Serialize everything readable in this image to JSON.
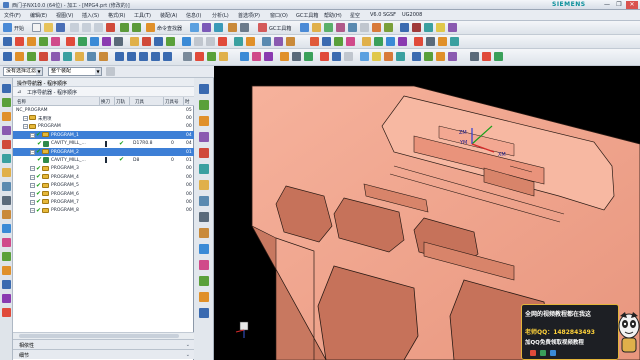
{
  "window": {
    "title": "西门子NX10.0 (64位) - 加工 - [MPG4.prt (修改的)]",
    "brand": "SIEMENS",
    "buttons": {
      "minimize": "—",
      "maximize": "❐",
      "close": "✕"
    }
  },
  "menu": [
    "文件(F)",
    "编辑(E)",
    "视图(V)",
    "插入(S)",
    "格式(R)",
    "工具(T)",
    "装配(A)",
    "信息(I)",
    "分析(L)",
    "首选项(P)",
    "窗口(O)",
    "GC工具箱",
    "帮助(H)",
    "星空",
    "V6.0  SGSF",
    "UG2008"
  ],
  "toolbar_labels": {
    "start": "开始",
    "view": "命令查找器",
    "gc": "GC工具箱"
  },
  "filter": {
    "selection": "没有选择过滤器",
    "scope": "整个装配"
  },
  "navigator": {
    "title": "操作导航器 - 程序顺序",
    "subtitle": "工序导航器 - 程序顺序",
    "columns": [
      "名称",
      "换刀",
      "刀轨",
      "刀具",
      "刀具号",
      "时"
    ],
    "rows": [
      {
        "name": "NC_PROGRAM",
        "change": "",
        "path": "",
        "tool": "",
        "num": "",
        "time": "05",
        "level": 0,
        "icon": "none",
        "selected": false
      },
      {
        "name": "未用项",
        "change": "",
        "path": "",
        "tool": "",
        "num": "",
        "time": "00",
        "level": 1,
        "icon": "folder",
        "selected": false
      },
      {
        "name": "PROGRAM",
        "change": "",
        "path": "",
        "tool": "",
        "num": "",
        "time": "00",
        "level": 1,
        "icon": "folder",
        "selected": false
      },
      {
        "name": "PROGRAM_1",
        "change": "",
        "path": "",
        "tool": "",
        "num": "",
        "time": "04",
        "level": 2,
        "icon": "folder",
        "selected": true
      },
      {
        "name": "CAVITY_MILL_...",
        "change": "bar",
        "path": "✔",
        "tool": "D17R0.8",
        "num": "0",
        "time": "04",
        "level": 3,
        "icon": "mill",
        "selected": false
      },
      {
        "name": "PROGRAM_2",
        "change": "",
        "path": "",
        "tool": "",
        "num": "",
        "time": "01",
        "level": 2,
        "icon": "folder",
        "selected": true
      },
      {
        "name": "CAVITY_MILL_...",
        "change": "bar",
        "path": "✔",
        "tool": "D8",
        "num": "0",
        "time": "01",
        "level": 3,
        "icon": "mill",
        "selected": false
      },
      {
        "name": "PROGRAM_3",
        "change": "",
        "path": "",
        "tool": "",
        "num": "",
        "time": "00",
        "level": 2,
        "icon": "folder",
        "selected": false
      },
      {
        "name": "PROGRAM_4",
        "change": "",
        "path": "",
        "tool": "",
        "num": "",
        "time": "00",
        "level": 2,
        "icon": "folder",
        "selected": false
      },
      {
        "name": "PROGRAM_5",
        "change": "",
        "path": "",
        "tool": "",
        "num": "",
        "time": "00",
        "level": 2,
        "icon": "folder",
        "selected": false
      },
      {
        "name": "PROGRAM_6",
        "change": "",
        "path": "",
        "tool": "",
        "num": "",
        "time": "00",
        "level": 2,
        "icon": "folder",
        "selected": false
      },
      {
        "name": "PROGRAM_7",
        "change": "",
        "path": "",
        "tool": "",
        "num": "",
        "time": "00",
        "level": 2,
        "icon": "folder",
        "selected": false
      },
      {
        "name": "PROGRAM_8",
        "change": "",
        "path": "",
        "tool": "",
        "num": "",
        "time": "00",
        "level": 2,
        "icon": "folder",
        "selected": false
      }
    ],
    "footer": [
      "相依性",
      "细节"
    ]
  },
  "axes": {
    "x": "XM",
    "y": "YM",
    "z": "ZM"
  },
  "promo": {
    "line1": "全网的视频教程都在我这",
    "line2": "老师QQ：1482843493",
    "line3": "加QQ免费领取视频教程"
  },
  "colors": {
    "part": "#f2a48e",
    "part_edge": "#2a1a14",
    "selection": "#3d7fd6",
    "promo_accent": "#ffd23a"
  }
}
